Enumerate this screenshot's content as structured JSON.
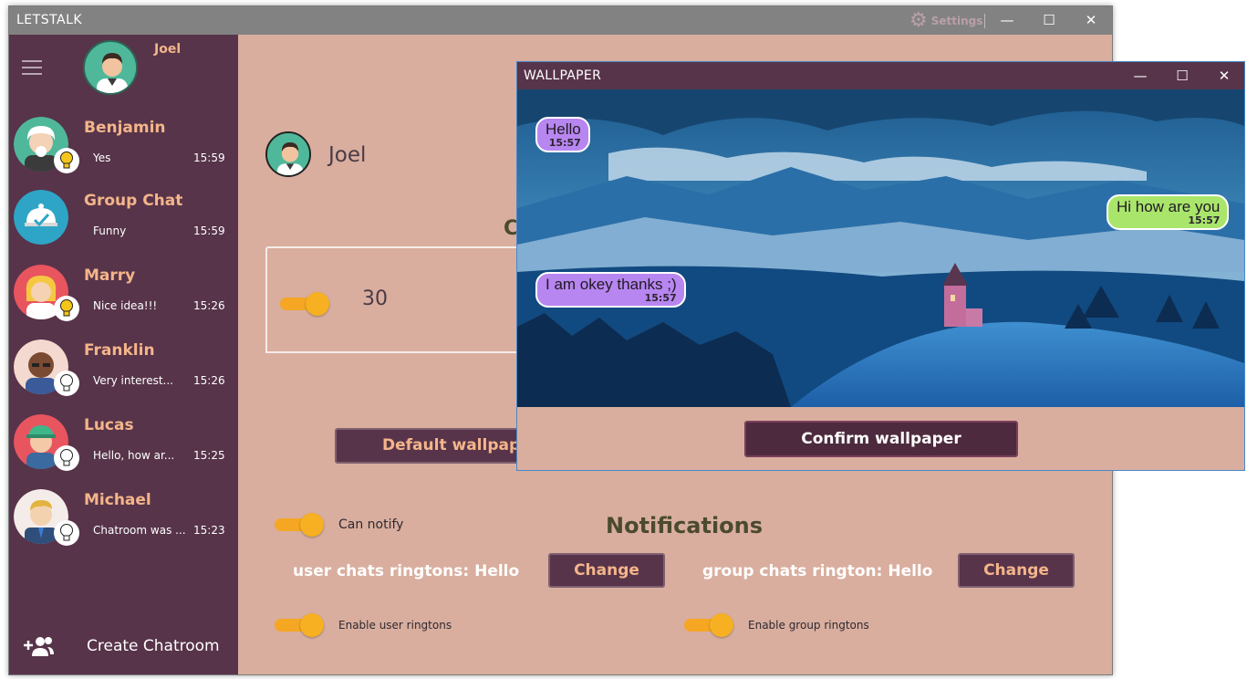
{
  "app": {
    "title": "LETSTALK",
    "settings_label": "Settings",
    "minimize_label": "—",
    "maximize_label": "☐",
    "close_label": "✕"
  },
  "sidebar": {
    "me": {
      "name": "Joel"
    },
    "chats": [
      {
        "name": "Benjamin",
        "last_message": "Yes",
        "time": "15:59",
        "bulb": "yellow"
      },
      {
        "name": "Group Chat",
        "last_message": "Funny",
        "time": "15:59",
        "bulb": "none"
      },
      {
        "name": "Marry",
        "last_message": "Nice idea!!!",
        "time": "15:26",
        "bulb": "yellow"
      },
      {
        "name": "Franklin",
        "last_message": "Very interest...",
        "time": "15:26",
        "bulb": "white"
      },
      {
        "name": "Lucas",
        "last_message": "Hello, how ar...",
        "time": "15:25",
        "bulb": "white"
      },
      {
        "name": "Michael",
        "last_message": "Chatroom was ...",
        "time": "15:23",
        "bulb": "white"
      }
    ],
    "create_chatroom_label": "Create Chatroom"
  },
  "profile": {
    "name": "Joel"
  },
  "text_size": {
    "section_letter": "C",
    "value": "30"
  },
  "wallpaper_section": {
    "default_button_label": "Default wallpap"
  },
  "notifications": {
    "title": "Notifications",
    "can_notify_label": "Can notify",
    "user_ringtone_label": "user chats ringtons:  Hello",
    "group_ringtone_label": "group chats rington: Hello",
    "change_user_label": "Change",
    "change_group_label": "Change",
    "enable_user_label": "Enable user ringtons",
    "enable_group_label": "Enable group ringtons"
  },
  "wallpaper_window": {
    "title": "WALLPAPER",
    "minimize_label": "—",
    "maximize_label": "☐",
    "close_label": "✕",
    "messages": [
      {
        "text": "Hello",
        "time": "15:57",
        "side": "incoming"
      },
      {
        "text": "Hi how are you",
        "time": "15:57",
        "side": "outgoing"
      },
      {
        "text": "I am okey thanks ;)",
        "time": "15:57",
        "side": "incoming"
      }
    ],
    "confirm_label": "Confirm wallpaper"
  },
  "colors": {
    "sidebar_bg": "#57344a",
    "content_bg": "#d9ae9e",
    "accent_orange": "#f4b58a",
    "toggle_yellow": "#f5a623",
    "bubble_incoming": "#b786f0",
    "bubble_outgoing": "#a9e56b"
  }
}
